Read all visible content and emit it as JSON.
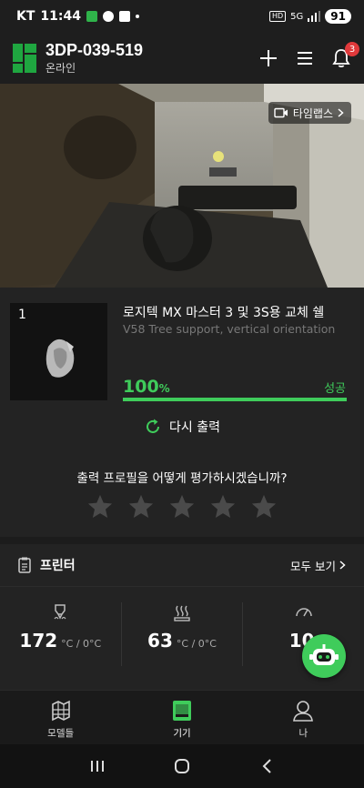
{
  "status_bar": {
    "carrier": "KT",
    "time": "11:44",
    "network": "5G",
    "battery": "91"
  },
  "header": {
    "device_name": "3DP-039-519",
    "connection_status": "온라인",
    "notification_count": "3"
  },
  "camera": {
    "timelapse_label": "타임랩스"
  },
  "print_job": {
    "plate_number": "1",
    "model_name": "로지텍 MX 마스터 3 및 3S용 교체 쉘",
    "model_profile": "V58 Tree support, vertical orientation",
    "progress_value": "100",
    "progress_unit": "%",
    "progress_fraction": 1.0,
    "result": "성공",
    "reprint_label": "다시 출력",
    "rating_question": "출력 프로필을 어떻게 평가하시겠습니까?",
    "rating_stars": 5,
    "rating_value": 0
  },
  "printer": {
    "title": "프린터",
    "view_all_label": "모두 보기",
    "temps": [
      {
        "icon": "nozzle-icon",
        "current": "172",
        "unit": "°C / 0°C"
      },
      {
        "icon": "heatbed-icon",
        "current": "63",
        "unit": "°C / 0°C"
      },
      {
        "icon": "fan-speed-icon",
        "current": "10",
        "unit": ""
      }
    ]
  },
  "bottom_nav": {
    "items": [
      {
        "label": "모델들",
        "icon": "models-icon"
      },
      {
        "label": "기기",
        "icon": "device-icon"
      },
      {
        "label": "나",
        "icon": "profile-icon"
      }
    ],
    "active_index": 1
  },
  "colors": {
    "accent": "#3fcc5b",
    "badge": "#e0393b",
    "background": "#1c1c1c"
  }
}
